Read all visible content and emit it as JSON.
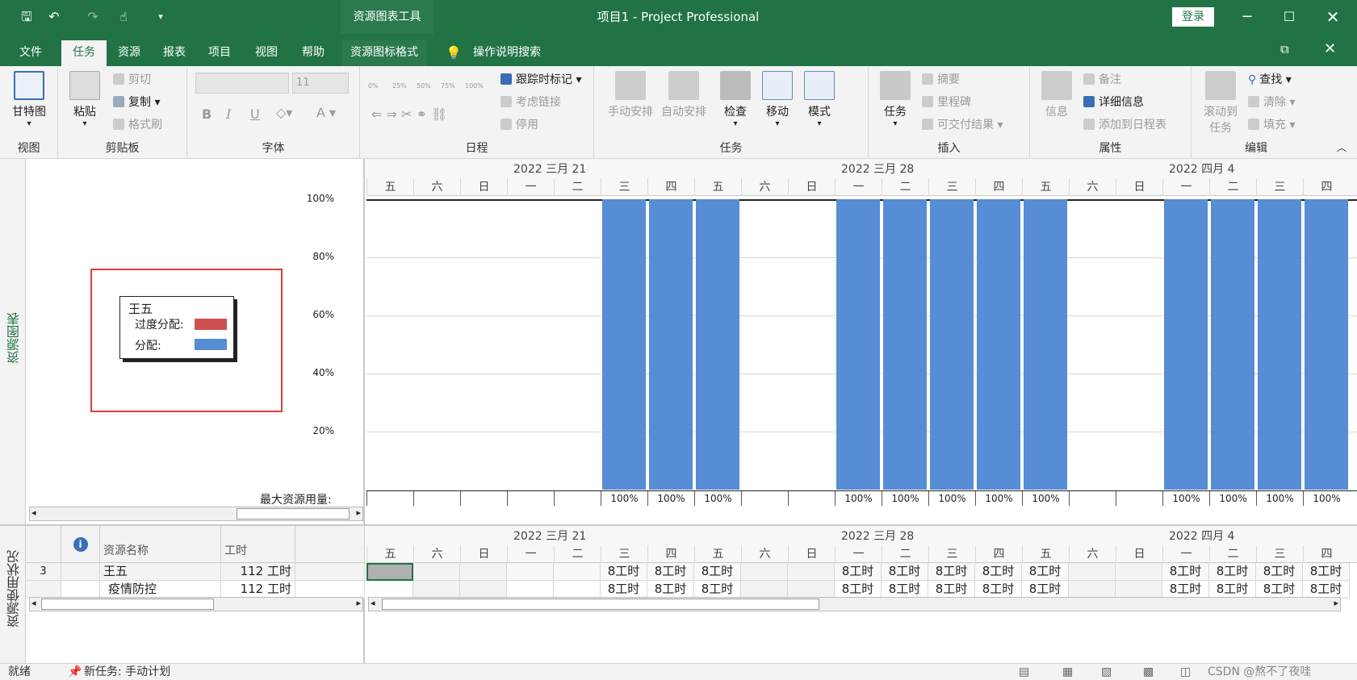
{
  "window": {
    "title": "项目1  -  Project Professional",
    "context_tool": "资源图表工具",
    "login": "登录"
  },
  "tabs": [
    "文件",
    "任务",
    "资源",
    "报表",
    "项目",
    "视图",
    "帮助",
    "资源图标格式"
  ],
  "active_tab": "任务",
  "tellme": "操作说明搜索",
  "ribbon": {
    "view": {
      "gantt": "甘特图",
      "label": "视图"
    },
    "clipboard": {
      "paste": "粘贴",
      "cut": "剪切",
      "copy": "复制",
      "format_painter": "格式刷",
      "label": "剪贴板"
    },
    "font": {
      "size": "11",
      "bold": "B",
      "italic": "I",
      "underline": "U",
      "label": "字体"
    },
    "schedule": {
      "pcts": [
        "0%",
        "25%",
        "50%",
        "75%",
        "100%"
      ],
      "track": "跟踪时标记",
      "respect_links": "考虑链接",
      "inactivate": "停用",
      "label": "日程"
    },
    "tasks": {
      "manual": "手动安排",
      "auto": "自动安排",
      "inspect": "检查",
      "move": "移动",
      "mode": "模式",
      "label": "任务"
    },
    "insert": {
      "task": "任务",
      "summary": "摘要",
      "milestone": "里程碑",
      "deliverable": "可交付结果",
      "label": "插入"
    },
    "properties": {
      "info": "信息",
      "notes": "备注",
      "details": "详细信息",
      "add_timeline": "添加到日程表",
      "label": "属性"
    },
    "editing": {
      "scroll_to": "滚动到",
      "scroll_to2": "任务",
      "find": "查找",
      "clear": "清除",
      "fill": "填充",
      "label": "编辑"
    }
  },
  "side_labels": {
    "top": "资源图表",
    "bottom": "资源使用状况"
  },
  "legend": {
    "name": "王五",
    "over": "过度分配:",
    "alloc": "分配:",
    "over_color": "#d05050",
    "alloc_color": "#568dd4"
  },
  "max_label": "最大资源用量:",
  "timescale": {
    "weeks": [
      {
        "label": "2022  三月  21"
      },
      {
        "label": "2022  三月  28"
      },
      {
        "label": "2022  四月  4"
      }
    ],
    "days": [
      "五",
      "六",
      "日",
      "一",
      "二",
      "三",
      "四",
      "五",
      "六",
      "日",
      "一",
      "二",
      "三",
      "四",
      "五",
      "六",
      "日",
      "一",
      "二",
      "三",
      "四"
    ]
  },
  "chart_data": {
    "type": "bar",
    "categories": [
      "五",
      "六",
      "日",
      "一",
      "二",
      "三",
      "四",
      "五",
      "六",
      "日",
      "一",
      "二",
      "三",
      "四",
      "五",
      "六",
      "日",
      "一",
      "二",
      "三",
      "四"
    ],
    "values": [
      0,
      0,
      0,
      0,
      0,
      100,
      100,
      100,
      0,
      0,
      100,
      100,
      100,
      100,
      100,
      0,
      0,
      100,
      100,
      100,
      100
    ],
    "ylim": [
      0,
      100
    ],
    "yticks": [
      "100%",
      "80%",
      "60%",
      "40%",
      "20%"
    ],
    "max_units": [
      "",
      "",
      "",
      "",
      "",
      "100%",
      "100%",
      "100%",
      "",
      "",
      "100%",
      "100%",
      "100%",
      "100%",
      "100%",
      "",
      "",
      "100%",
      "100%",
      "100%",
      "100%"
    ],
    "bar_color": "#568dd4",
    "grid": true
  },
  "sheet": {
    "headers": {
      "name": "资源名称",
      "work": "工时"
    },
    "rows": [
      {
        "id": "3",
        "name": "王五",
        "work": "112 工时",
        "cells": [
          "",
          "",
          "",
          "",
          "",
          "8工时",
          "8工时",
          "8工时",
          "",
          "",
          "8工时",
          "8工时",
          "8工时",
          "8工时",
          "8工时",
          "",
          "",
          "8工时",
          "8工时",
          "8工时",
          "8工时"
        ]
      },
      {
        "id": "",
        "name": "疫情防控",
        "work": "112 工时",
        "cells": [
          "",
          "",
          "",
          "",
          "",
          "8工时",
          "8工时",
          "8工时",
          "",
          "",
          "8工时",
          "8工时",
          "8工时",
          "8工时",
          "8工时",
          "",
          "",
          "8工时",
          "8工时",
          "8工时",
          "8工时"
        ]
      }
    ]
  },
  "status": {
    "ready": "就绪",
    "new_task": "新任务: 手动计划",
    "watermark": "CSDN @熬不了夜哇"
  },
  "colors": {
    "brand": "#217346"
  }
}
